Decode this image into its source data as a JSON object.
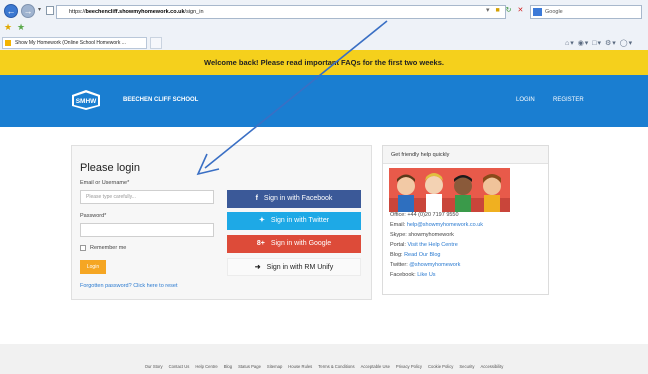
{
  "browser": {
    "url_prefix": "https://",
    "url_host": "beechencliff.showmyhomework.co.uk",
    "url_path": "/sign_in",
    "search_placeholder": "Google",
    "tab_title": "Show My Homework (Online School Homework ..."
  },
  "banner": {
    "text": "Welcome back! Please read important FAQs for the first two weeks."
  },
  "header": {
    "logo_text": "SMHW",
    "school_name": "BEECHEN CLIFF SCHOOL",
    "nav": {
      "login": "LOGIN",
      "register": "REGISTER"
    }
  },
  "login": {
    "title": "Please login",
    "email_label": "Email or Username*",
    "email_placeholder": "Please type carefully...",
    "password_label": "Password*",
    "remember_label": "Remember me",
    "login_button": "Login",
    "forgot_link": "Forgotten password? Click here to reset"
  },
  "social": {
    "facebook": "Sign in with Facebook",
    "twitter": "Sign in with Twitter",
    "google": "Sign in with Google",
    "rm": "Sign in with RM Unify"
  },
  "help": {
    "title": "Get friendly help quickly",
    "lines": [
      {
        "label": "Office:",
        "value": "+44 (0)20 7197 9550"
      },
      {
        "label": "Email:",
        "value": "help@showmyhomework.co.uk"
      },
      {
        "label": "Skype:",
        "value": "showmyhomework"
      },
      {
        "label": "Portal:",
        "value": "Visit the Help Centre"
      },
      {
        "label": "Blog:",
        "value": "Read Our Blog"
      },
      {
        "label": "Twitter:",
        "value": "@showmyhomework"
      },
      {
        "label": "Facebook:",
        "value": "Like Us"
      }
    ]
  },
  "footer": {
    "links": [
      "Our Story",
      "Contact Us",
      "Help Centre",
      "Blog",
      "Status Page",
      "Sitemap",
      "House Rules",
      "Terms & Conditions",
      "Acceptable Use",
      "Privacy Policy",
      "Cookie Policy",
      "Security",
      "Accessibility"
    ]
  },
  "colors": {
    "banner": "#f5d01c",
    "header": "#1a7ed1",
    "facebook": "#3b5998",
    "twitter": "#1ea9e6",
    "google": "#dd4b39",
    "login_button": "#f5a623",
    "arrow": "#3a6fc4"
  }
}
